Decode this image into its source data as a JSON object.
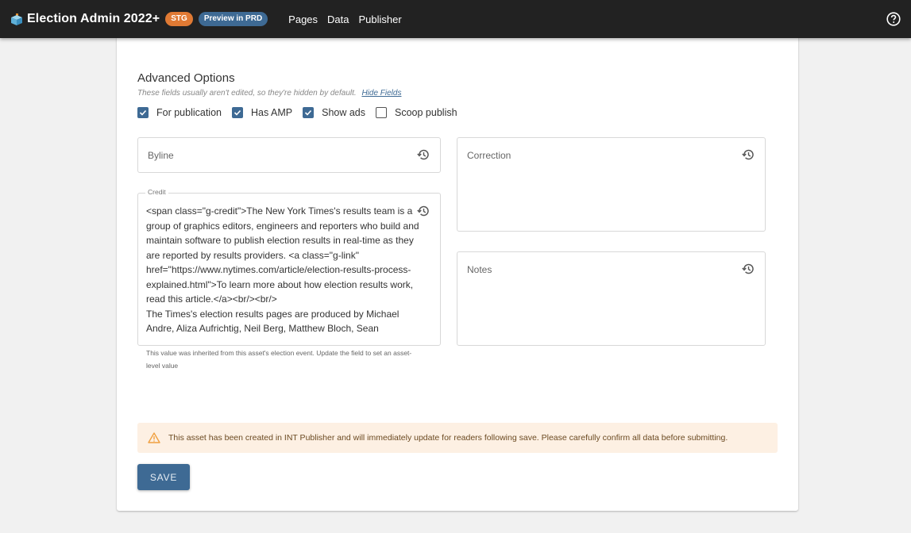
{
  "header": {
    "logo_icon": "ballot-box-icon",
    "title": "Election Admin 2022+",
    "badges": [
      {
        "label": "STG",
        "color": "#e07a34"
      },
      {
        "label": "Preview in PRD",
        "color": "#3e6a94"
      }
    ],
    "nav": [
      "Pages",
      "Data",
      "Publisher"
    ],
    "help_icon": "help-circle-icon"
  },
  "advanced": {
    "title": "Advanced Options",
    "subtitle": "These fields usually aren't edited, so they're hidden by default.",
    "hide_link": "Hide Fields",
    "checkboxes": [
      {
        "label": "For publication",
        "checked": true
      },
      {
        "label": "Has AMP",
        "checked": true
      },
      {
        "label": "Show ads",
        "checked": true
      },
      {
        "label": "Scoop publish",
        "checked": false
      }
    ]
  },
  "fields": {
    "byline": {
      "placeholder": "Byline",
      "icon": "history-icon"
    },
    "credit": {
      "label": "Credit",
      "value": "<span class=\"g-credit\">The New York Times's results team is a group of graphics editors, engineers and reporters who build and maintain software to publish election results in real-time as they are reported by results providers. <a class=\"g-link\" href=\"https://www.nytimes.com/article/election-results-process-explained.html\">To learn more about how election results work, read this article.</a><br/><br/>\nThe Times's election results pages are produced by Michael Andre, Aliza Aufrichtig, Neil Berg, Matthew Bloch, Sean",
      "helper": "This value was inherited from this asset's election event. Update the field to set an asset-level value",
      "icon": "history-icon"
    },
    "correction": {
      "placeholder": "Correction",
      "icon": "history-icon"
    },
    "notes": {
      "placeholder": "Notes",
      "icon": "history-icon"
    }
  },
  "alert": {
    "icon": "warning-icon",
    "message": "This asset has been created in INT Publisher and will immediately update for readers following save. Please carefully confirm all data before submitting."
  },
  "actions": {
    "save_label": "SAVE"
  }
}
